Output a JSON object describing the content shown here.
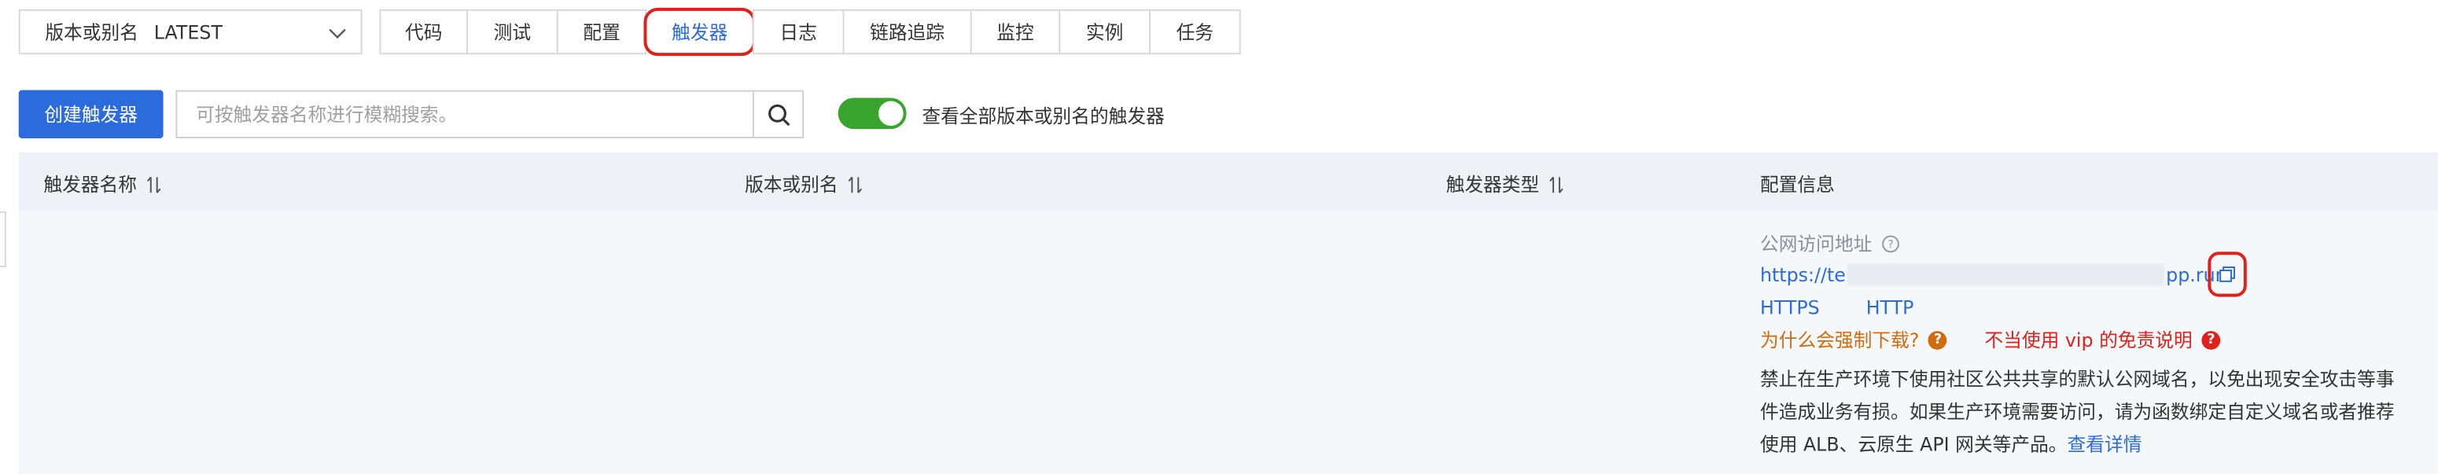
{
  "version_select": {
    "label": "版本或别名",
    "value": "LATEST"
  },
  "tabs": [
    {
      "label": "代码"
    },
    {
      "label": "测试"
    },
    {
      "label": "配置"
    },
    {
      "label": "触发器"
    },
    {
      "label": "日志"
    },
    {
      "label": "链路追踪"
    },
    {
      "label": "监控"
    },
    {
      "label": "实例"
    },
    {
      "label": "任务"
    }
  ],
  "toolbar": {
    "create_label": "创建触发器",
    "search_placeholder": "可按触发器名称进行模糊搜索。",
    "toggle_label": "查看全部版本或别名的触发器",
    "toggle_on": true
  },
  "table": {
    "headers": [
      "触发器名称",
      "版本或别名",
      "触发器类型",
      "配置信息"
    ]
  },
  "config": {
    "public_url_title": "公网访问地址",
    "url_prefix": "https://te",
    "url_suffix": "pp.run",
    "protocols": [
      "HTTPS",
      "HTTP"
    ],
    "warn_download": "为什么会强制下载?",
    "warn_vip": "不当使用 vip 的免责说明",
    "note": "禁止在生产环境下使用社区公共共享的默认公网域名，以免出现安全攻击等事件造成业务有损。如果生产环境需要访问，请为函数绑定自定义域名或者推荐使用 ALB、云原生 API 网关等产品。",
    "note_link": "查看详情"
  },
  "colors": {
    "accent": "#2b6bdb",
    "toggle": "#3aa52e",
    "warning": "#d26b0c",
    "danger": "#e0201a"
  }
}
